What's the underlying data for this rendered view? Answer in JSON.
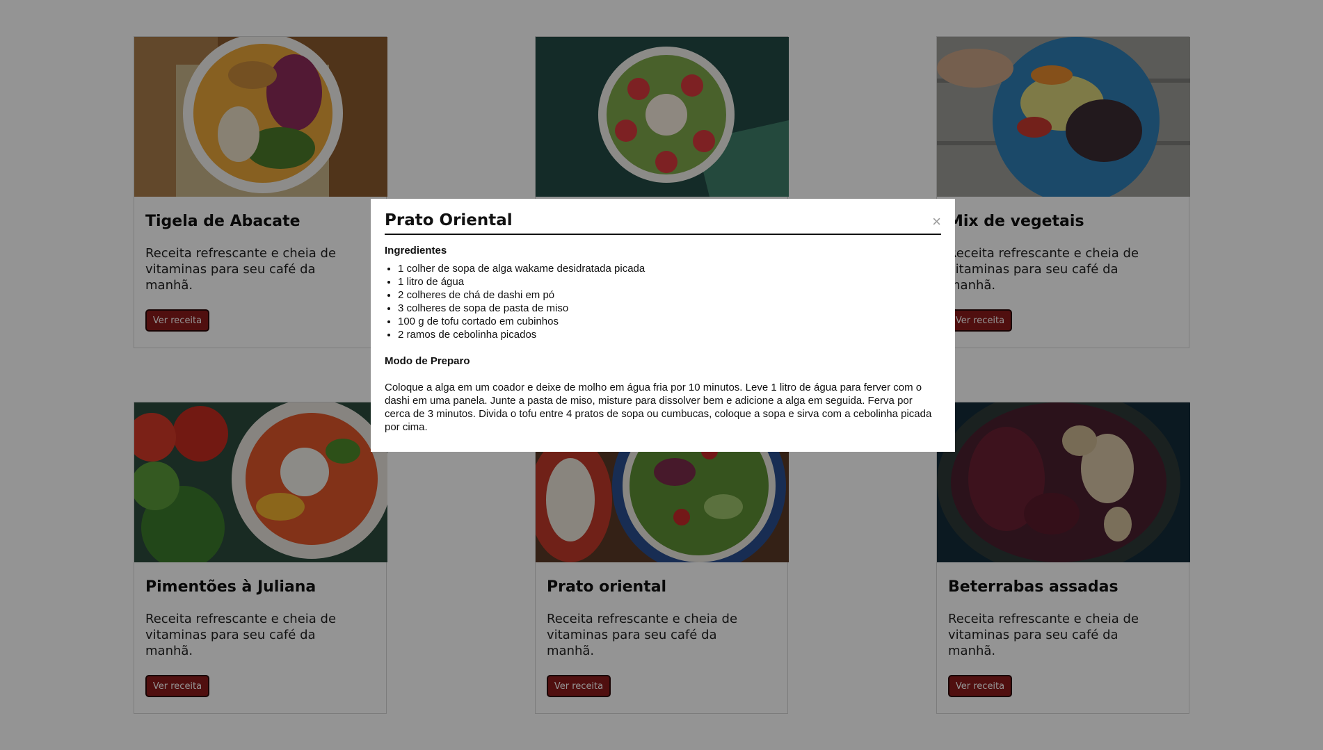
{
  "cards": [
    {
      "title": "Tigela de Abacate",
      "desc": "Receita refrescante e cheia de vitaminas para seu café da manhã.",
      "button": "Ver receita"
    },
    {
      "title": "",
      "desc": "",
      "button": ""
    },
    {
      "title": "Mix de vegetais",
      "desc": "Receita refrescante e cheia de vitaminas para seu café da manhã.",
      "button": "Ver receita"
    },
    {
      "title": "Pimentões à Juliana",
      "desc": "Receita refrescante e cheia de vitaminas para seu café da manhã.",
      "button": "Ver receita"
    },
    {
      "title": "Prato oriental",
      "desc": "Receita refrescante e cheia de vitaminas para seu café da manhã.",
      "button": "Ver receita"
    },
    {
      "title": "Beterrabas assadas",
      "desc": "Receita refrescante e cheia de vitaminas para seu café da manhã.",
      "button": "Ver receita"
    }
  ],
  "modal": {
    "title": "Prato Oriental",
    "close": "×",
    "ingredients_heading": "Ingredientes",
    "ingredients": [
      "1 colher de sopa de alga wakame desidratada picada",
      "1 litro de água",
      "2 colheres de chá de dashi em pó",
      "3 colheres de sopa de pasta de miso",
      "100 g de tofu cortado em cubinhos",
      "2 ramos de cebolinha picados"
    ],
    "prep_heading": "Modo de Preparo",
    "prep_text": "Coloque a alga em um coador e deixe de molho em água fria por 10 minutos. Leve 1 litro de água para ferver com o dashi em uma panela. Junte a pasta de miso, misture para dissolver bem e adicione a alga em seguida. Ferva por cerca de 3 minutos. Divida o tofu entre 4 pratos de sopa ou cumbucas, coloque a sopa e sirva com a cebolinha picada por cima."
  },
  "colors": {
    "button": "#8b1a1a",
    "overlay": "rgba(0,0,0,0.42)"
  }
}
